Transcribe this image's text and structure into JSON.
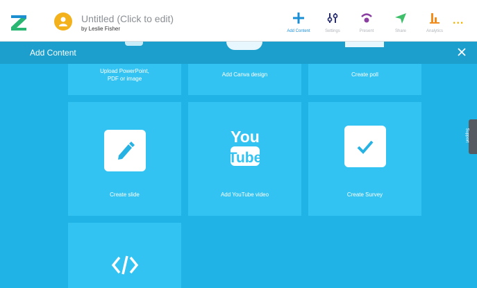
{
  "header": {
    "logo_icon": "zoho-z-logo-icon",
    "avatar_icon": "user-icon",
    "doc_title": "Untitled (Click to edit)",
    "doc_author": "by Leslie Fisher",
    "nav": [
      {
        "label": "Add Content",
        "icon": "plus-icon",
        "color": "#1a8fd6"
      },
      {
        "label": "Settings",
        "icon": "sliders-icon",
        "color": "#2a2f6e"
      },
      {
        "label": "Present",
        "icon": "present-icon",
        "color": "#8b3fa0"
      },
      {
        "label": "Share",
        "icon": "send-icon",
        "color": "#3fbf6a"
      },
      {
        "label": "Analytics",
        "icon": "bar-chart-icon",
        "color": "#f28c1c"
      }
    ],
    "more_label": "..."
  },
  "overlay": {
    "title": "Add Content",
    "close_icon": "close-icon",
    "tiles": [
      {
        "label": "Upload PowerPoint,\nPDF or image",
        "icon": "upload-icon"
      },
      {
        "label": "Add Canva design",
        "icon": "canva-icon"
      },
      {
        "label": "Create poll",
        "icon": "poll-icon"
      },
      {
        "label": "Create slide",
        "icon": "pencil-icon"
      },
      {
        "label": "Add YouTube video",
        "icon": "youtube-icon"
      },
      {
        "label": "Create Survey",
        "icon": "checkmark-icon"
      },
      {
        "label": "",
        "icon": "code-icon"
      }
    ]
  },
  "support_tab": "Support",
  "colors": {
    "overlay_bg": "#1fb3e6",
    "tile_bg": "#33c3f2",
    "header_bg": "#1c9fcd"
  }
}
